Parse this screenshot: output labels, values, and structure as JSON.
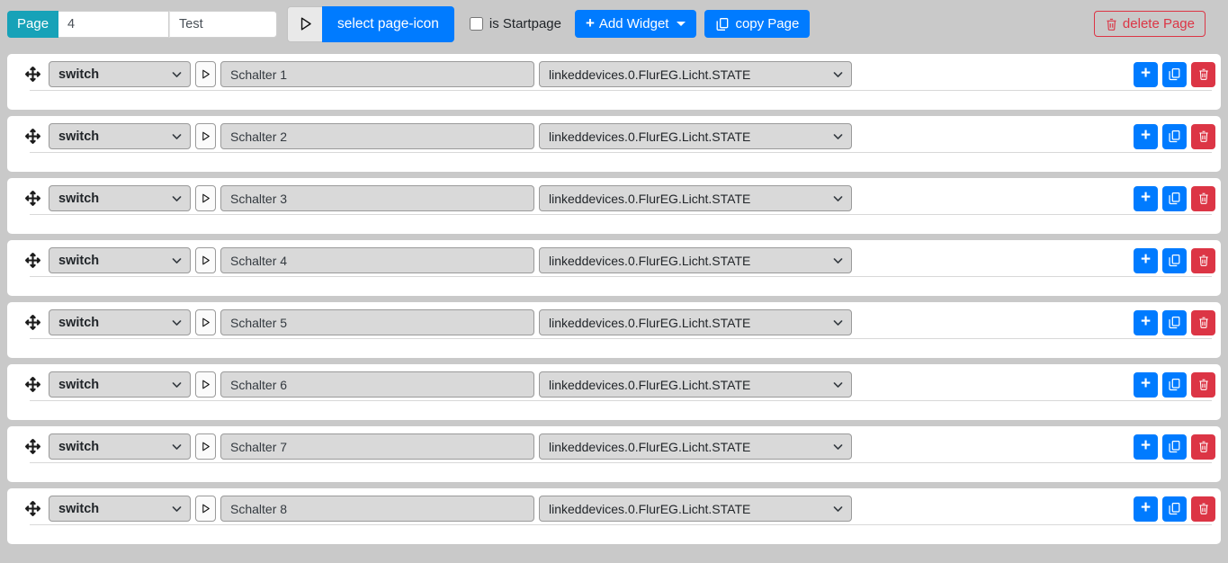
{
  "header": {
    "page_label": "Page",
    "page_number": "4",
    "page_name": "Test",
    "select_page_icon_label": "select page-icon",
    "is_startpage_label": "is Startpage",
    "is_startpage_checked": false,
    "add_widget_label": "Add Widget",
    "copy_page_label": "copy Page",
    "delete_page_label": "delete Page"
  },
  "widgets": [
    {
      "type": "switch",
      "name": "Schalter 1",
      "oid": "linkeddevices.0.FlurEG.Licht.STATE"
    },
    {
      "type": "switch",
      "name": "Schalter 2",
      "oid": "linkeddevices.0.FlurEG.Licht.STATE"
    },
    {
      "type": "switch",
      "name": "Schalter 3",
      "oid": "linkeddevices.0.FlurEG.Licht.STATE"
    },
    {
      "type": "switch",
      "name": "Schalter 4",
      "oid": "linkeddevices.0.FlurEG.Licht.STATE"
    },
    {
      "type": "switch",
      "name": "Schalter 5",
      "oid": "linkeddevices.0.FlurEG.Licht.STATE"
    },
    {
      "type": "switch",
      "name": "Schalter 6",
      "oid": "linkeddevices.0.FlurEG.Licht.STATE"
    },
    {
      "type": "switch",
      "name": "Schalter 7",
      "oid": "linkeddevices.0.FlurEG.Licht.STATE"
    },
    {
      "type": "switch",
      "name": "Schalter 8",
      "oid": "linkeddevices.0.FlurEG.Licht.STATE"
    }
  ],
  "icons": {
    "move": "arrows-move-icon",
    "play": "play-outline-icon",
    "chevron": "chevron-down-icon",
    "plus": "plus-icon",
    "copy": "copy-icon",
    "trash": "trash-icon",
    "caret": "caret-down-icon"
  },
  "colors": {
    "page_background": "#c9c9c9",
    "card_background": "#ffffff",
    "accent_teal": "#17a2b8",
    "accent_blue": "#007bff",
    "accent_red": "#dc3545",
    "field_fill": "#d9d9d9",
    "field_border": "#9a9a9a"
  }
}
